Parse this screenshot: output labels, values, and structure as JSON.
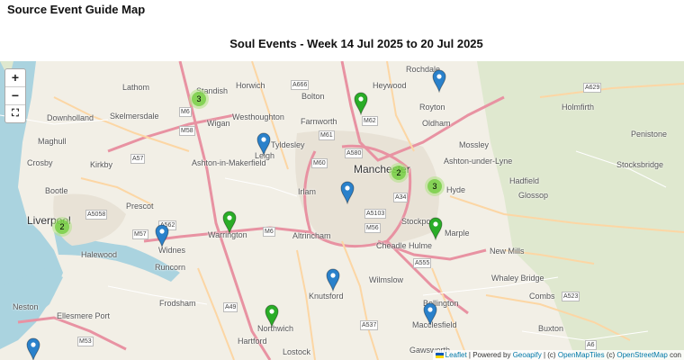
{
  "app": {
    "title": "Source Event Guide Map"
  },
  "map": {
    "heading": "Soul Events - Week 14 Jul 2025 to 20 Jul 2025",
    "controls": {
      "zoom_in": "+",
      "zoom_out": "−",
      "fullscreen": "⛶"
    },
    "places": [
      {
        "name": "Rochdale"
      },
      {
        "name": "Horwich"
      },
      {
        "name": "Heywood"
      },
      {
        "name": "Bolton"
      },
      {
        "name": "Lathom"
      },
      {
        "name": "Standish"
      },
      {
        "name": "Royton"
      },
      {
        "name": "Holmfirth"
      },
      {
        "name": "Skelmersdale"
      },
      {
        "name": "Westhoughton"
      },
      {
        "name": "Farnworth"
      },
      {
        "name": "Wigan"
      },
      {
        "name": "Downholland"
      },
      {
        "name": "Oldham"
      },
      {
        "name": "Maghull"
      },
      {
        "name": "Tyldesley"
      },
      {
        "name": "Penistone"
      },
      {
        "name": "Mossley"
      },
      {
        "name": "Crosby"
      },
      {
        "name": "Kirkby"
      },
      {
        "name": "Ashton-in-Makerfield"
      },
      {
        "name": "Leigh"
      },
      {
        "name": "Ashton-under-Lyne"
      },
      {
        "name": "Stocksbridge"
      },
      {
        "name": "Manchester"
      },
      {
        "name": "Bootle"
      },
      {
        "name": "Irlam"
      },
      {
        "name": "Hyde"
      },
      {
        "name": "Hadfield"
      },
      {
        "name": "Glossop"
      },
      {
        "name": "Prescot"
      },
      {
        "name": "Liverpool"
      },
      {
        "name": "Warrington"
      },
      {
        "name": "Altrincham"
      },
      {
        "name": "Stockport"
      },
      {
        "name": "Halewood"
      },
      {
        "name": "Widnes"
      },
      {
        "name": "Marple"
      },
      {
        "name": "Cheadle Hulme"
      },
      {
        "name": "New Mills"
      },
      {
        "name": "Runcorn"
      },
      {
        "name": "Whaley Bridge"
      },
      {
        "name": "Wilmslow"
      },
      {
        "name": "Knutsford"
      },
      {
        "name": "Frodsham"
      },
      {
        "name": "Combs"
      },
      {
        "name": "Neston"
      },
      {
        "name": "Ellesmere Port"
      },
      {
        "name": "Bollington"
      },
      {
        "name": "Northwich"
      },
      {
        "name": "Macclesfield"
      },
      {
        "name": "Buxton"
      },
      {
        "name": "Hartford"
      },
      {
        "name": "Gawsworth"
      },
      {
        "name": "Lostock"
      }
    ],
    "roads": [
      "A666",
      "M6",
      "M62",
      "A629",
      "M58",
      "A580",
      "M61",
      "M60",
      "A57",
      "A5058",
      "M57",
      "A562",
      "A34",
      "A5103",
      "M56",
      "A555",
      "M6",
      "A49",
      "A537",
      "A523",
      "A6",
      "M53"
    ],
    "markers": [
      {
        "color": "blue",
        "place": "Royton"
      },
      {
        "color": "green",
        "place": "Heywood"
      },
      {
        "color": "blue",
        "place": "Leigh"
      },
      {
        "color": "blue",
        "place": "Manchester"
      },
      {
        "color": "green",
        "place": "Warrington"
      },
      {
        "color": "blue",
        "place": "Widnes"
      },
      {
        "color": "green",
        "place": "Marple"
      },
      {
        "color": "blue",
        "place": "Knutsford"
      },
      {
        "color": "green",
        "place": "Northwich"
      },
      {
        "color": "blue",
        "place": "Macclesfield"
      },
      {
        "color": "blue",
        "place": "Neston"
      }
    ],
    "clusters": [
      {
        "count": "3",
        "place": "Standish"
      },
      {
        "count": "2",
        "place": "Manchester"
      },
      {
        "count": "3",
        "place": "Hyde"
      },
      {
        "count": "2",
        "place": "Liverpool"
      }
    ],
    "attribution": {
      "leaflet": "Leaflet",
      "powered": "| Powered by",
      "geoapify": "Geoapify",
      "mid": "| (c)",
      "openmaptiles": "OpenMapTiles",
      "mid2": "(c)",
      "osm": "OpenStreetMap",
      "tail": "con"
    },
    "colors": {
      "marker_blue": "#2a81cb",
      "marker_green": "#2aad27",
      "cluster": "#6ecc39"
    }
  }
}
